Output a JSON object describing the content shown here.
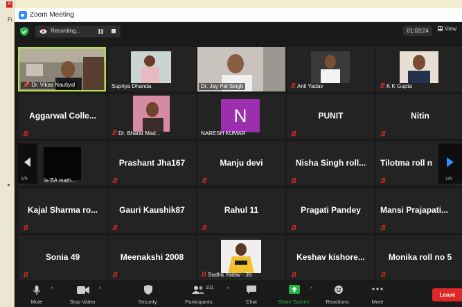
{
  "window": {
    "title": "Zoom Meeting"
  },
  "recording": {
    "label": "Recording..."
  },
  "timer": "01:03:24",
  "view_label": "View",
  "gallery": {
    "row1": [
      {
        "label": "Dr. Vikas Nautiyal"
      },
      {
        "label": "Supriya Dhanda"
      },
      {
        "label": "Dr. Jay Pal Singh"
      },
      {
        "label": "Anil Yadav"
      },
      {
        "label": "K K Gupta"
      }
    ],
    "row2": [
      {
        "name": "Aggarwal  Colle..."
      },
      {
        "label": "Dr. Bharat Mad..."
      },
      {
        "label": "NARESH KUMAR",
        "avatar_letter": "N"
      },
      {
        "name": "PUNIT"
      },
      {
        "name": "Nitin"
      }
    ],
    "row3": [
      {
        "label": "le BA math..."
      },
      {
        "name": "Prashant Jha167"
      },
      {
        "name": "Manju devi"
      },
      {
        "name": "Nisha Singh roll..."
      },
      {
        "name": "Tilotma roll n"
      }
    ],
    "row4": [
      {
        "name": "Kajal  Sharma  ro..."
      },
      {
        "name": "Gauri Kaushik87"
      },
      {
        "name": "Rahul 11"
      },
      {
        "name": "Pragati Pandey"
      },
      {
        "name": "Mansi  Prajapati..."
      }
    ],
    "row5": [
      {
        "name": "Sonia 49"
      },
      {
        "name": "Meenakshi 2008"
      },
      {
        "label": "Sudha Yadav - 39"
      },
      {
        "name": "Keshav  kishore..."
      },
      {
        "name": "Monika roll no 5"
      }
    ],
    "page_left": "1/5",
    "page_right": "1/5"
  },
  "toolbar": {
    "mute": "Mute",
    "stop_video": "Stop Video",
    "security": "Security",
    "participants": "Participants",
    "participants_count": "101",
    "chat": "Chat",
    "share_screen": "Share Screen",
    "reactions": "Reactions",
    "more": "More",
    "leave": "Leave"
  },
  "colors": {
    "accent": "#2d8cff",
    "leave": "#e02828",
    "share": "#22b44a",
    "active_speaker": "#b6e34b",
    "avatar": "#9b2fae"
  }
}
